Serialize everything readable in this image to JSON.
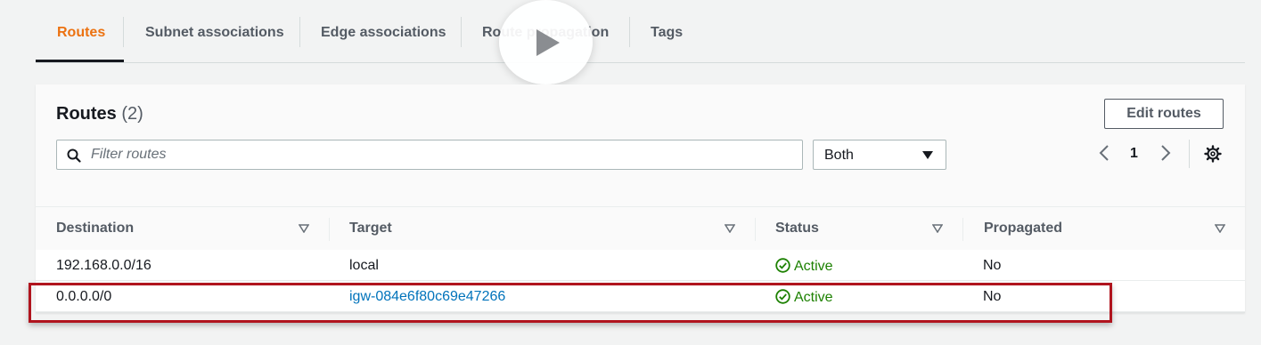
{
  "tabs": [
    {
      "label": "Routes",
      "active": true
    },
    {
      "label": "Subnet associations",
      "active": false
    },
    {
      "label": "Edge associations",
      "active": false
    },
    {
      "label": "Route propagation",
      "active": false
    },
    {
      "label": "Tags",
      "active": false
    }
  ],
  "panel": {
    "title": "Routes",
    "count": "(2)",
    "edit_button": "Edit routes",
    "filter_placeholder": "Filter routes",
    "filter_select": "Both",
    "page": "1"
  },
  "table": {
    "columns": [
      "Destination",
      "Target",
      "Status",
      "Propagated"
    ],
    "rows": [
      {
        "destination": "192.168.0.0/16",
        "target": "local",
        "target_is_link": false,
        "status": "Active",
        "propagated": "No"
      },
      {
        "destination": "0.0.0.0/0",
        "target": "igw-084e6f80c69e47266",
        "target_is_link": true,
        "status": "Active",
        "propagated": "No"
      }
    ]
  },
  "colors": {
    "active_tab": "#ec7211",
    "link": "#0073bb",
    "status_active": "#1d8102",
    "highlight": "#b0141e"
  },
  "icons": [
    "search-icon",
    "caret-down-icon",
    "chevron-left-icon",
    "chevron-right-icon",
    "settings-gear-icon",
    "sort-icon",
    "check-circle-icon",
    "play-icon"
  ]
}
